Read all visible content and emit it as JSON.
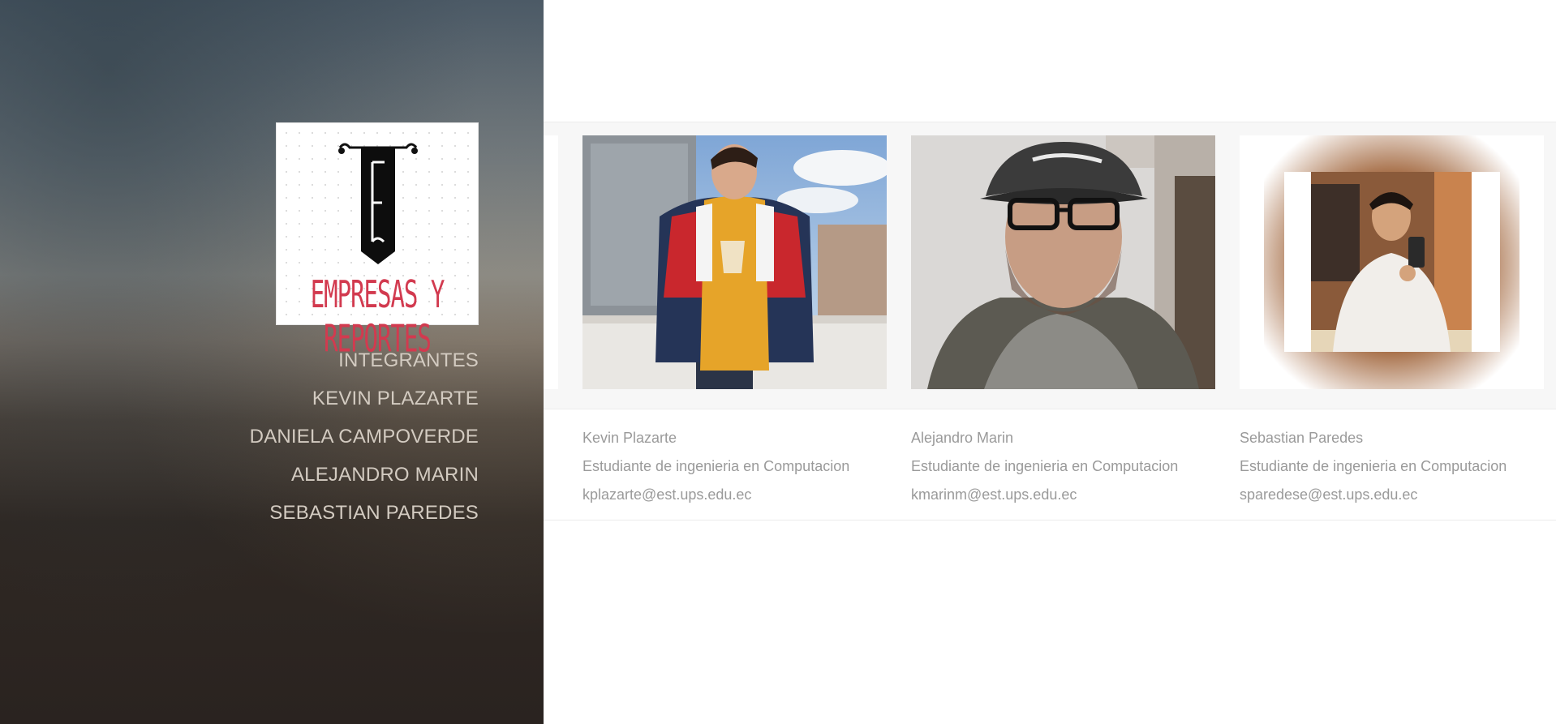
{
  "logo": {
    "text": "EMPRESAS Y REPORTES"
  },
  "nav": {
    "items": [
      {
        "label": "INTEGRANTES"
      },
      {
        "label": "KEVIN PLAZARTE"
      },
      {
        "label": "DANIELA CAMPOVERDE"
      },
      {
        "label": "ALEJANDRO MARIN"
      },
      {
        "label": "SEBASTIAN PAREDES"
      }
    ]
  },
  "members": [
    {
      "name": "Kevin Plazarte",
      "role": "Estudiante de ingenieria en Computacion",
      "email": "kplazarte@est.ups.edu.ec"
    },
    {
      "name": "Alejandro Marin",
      "role": "Estudiante de ingenieria en Computacion",
      "email": "kmarinm@est.ups.edu.ec"
    },
    {
      "name": "Sebastian Paredes",
      "role": "Estudiante de ingenieria en Computacion",
      "email": "sparedese@est.ups.edu.ec"
    }
  ],
  "colors": {
    "nav_text": "#d3cbc1",
    "caption_text": "#9a9a9a",
    "logo_red": "#d23a4f"
  }
}
